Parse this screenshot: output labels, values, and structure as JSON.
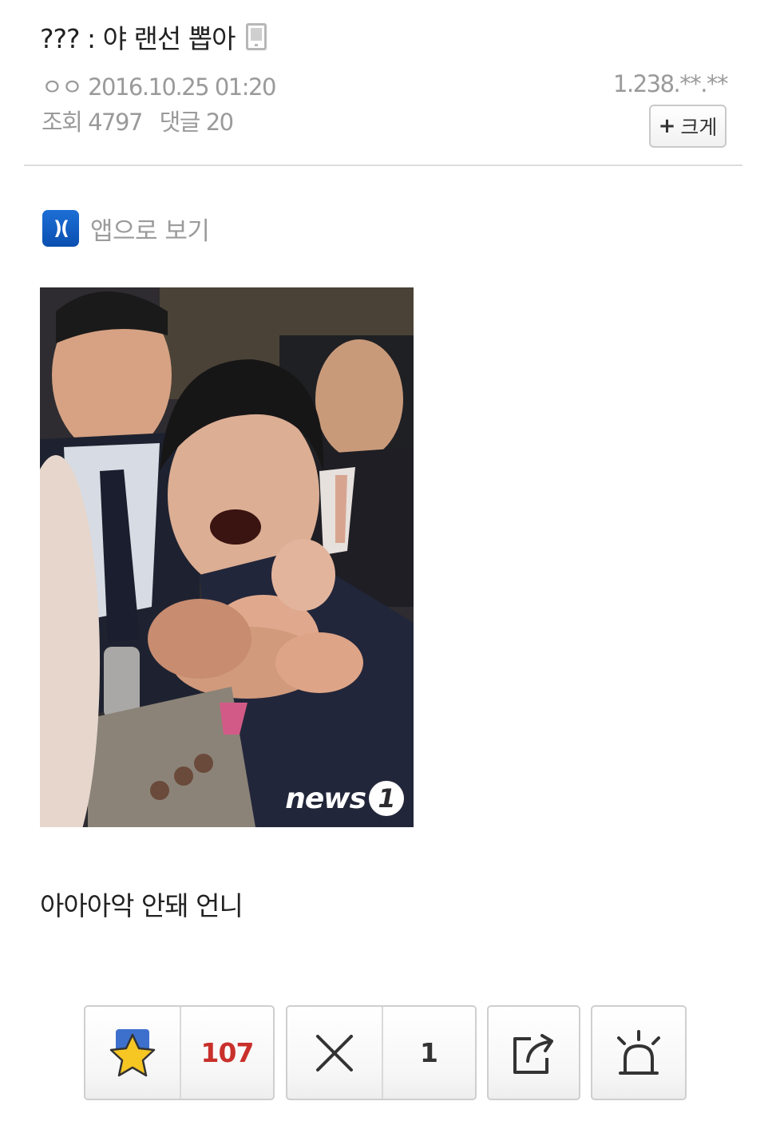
{
  "post": {
    "title": "??? : 야 랜선 뽑아",
    "author_date": "ㅇㅇ 2016.10.25 01:20",
    "ip": "1.238.**.**",
    "views_label": "조회",
    "views": "4797",
    "comments_label": "댓글",
    "comments": "20",
    "enlarge_label": "크게",
    "enlarge_plus": "+",
    "body": "아아아악 안돼 언니"
  },
  "app_view": {
    "logo_text": ")(",
    "label": "앱으로 보기"
  },
  "photo": {
    "watermark_text": "news",
    "watermark_num": "1"
  },
  "actions": {
    "recommend_count": "107",
    "dislike_count": "1"
  },
  "colors": {
    "recommend_count": "#c9302c",
    "app_logo": "#1565c0"
  }
}
